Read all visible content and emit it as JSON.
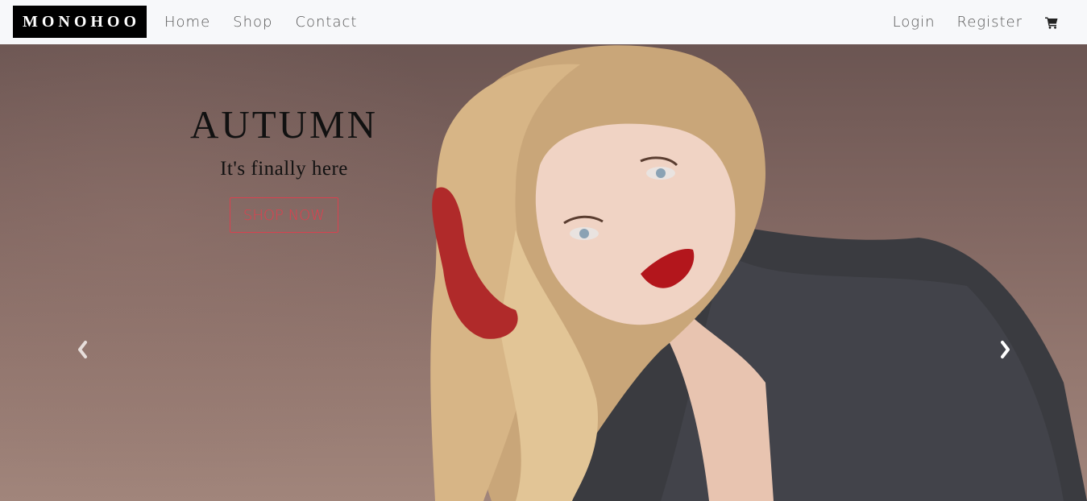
{
  "navbar": {
    "brand": "MONOHOO",
    "left_links": [
      {
        "label": "Home"
      },
      {
        "label": "Shop"
      },
      {
        "label": "Contact"
      }
    ],
    "right_links": [
      {
        "label": "Login"
      },
      {
        "label": "Register"
      }
    ],
    "cart_icon": "shopping-cart-icon"
  },
  "hero": {
    "title": "AUTUMN",
    "subtitle": "It's finally here",
    "cta_label": "SHOP NOW",
    "prev_icon": "chevron-left-icon",
    "next_icon": "chevron-right-icon"
  },
  "colors": {
    "navbar_bg": "#f7f8fa",
    "brand_bg": "#000000",
    "cta_accent": "#e23e4e",
    "hero_bg": "#7f6560"
  }
}
